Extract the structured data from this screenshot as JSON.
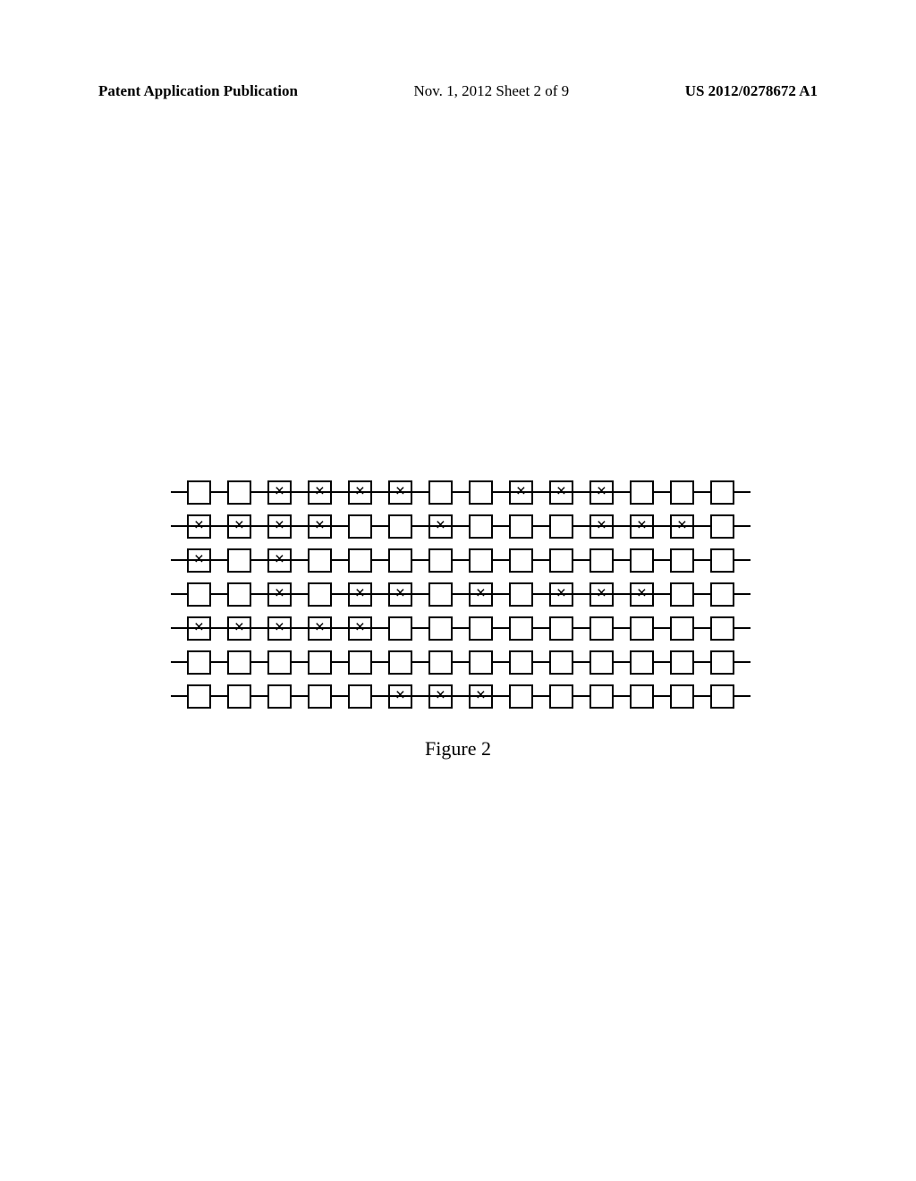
{
  "header": {
    "left": "Patent Application Publication",
    "center": "Nov. 1, 2012   Sheet 2 of 9",
    "right": "US 2012/0278672 A1"
  },
  "caption": "Figure 2",
  "chart_data": {
    "type": "table",
    "title": "Figure 2",
    "description": "7 rows of 14 cells each; 1 = marked (x with strike-through), 0 = empty",
    "rows": [
      [
        0,
        0,
        1,
        1,
        1,
        1,
        0,
        0,
        1,
        1,
        1,
        0,
        0,
        0
      ],
      [
        1,
        1,
        1,
        1,
        0,
        0,
        1,
        0,
        0,
        0,
        1,
        1,
        1,
        0
      ],
      [
        1,
        0,
        1,
        0,
        0,
        0,
        0,
        0,
        0,
        0,
        0,
        0,
        0,
        0
      ],
      [
        0,
        0,
        1,
        0,
        1,
        1,
        0,
        1,
        0,
        1,
        1,
        1,
        0,
        0
      ],
      [
        1,
        1,
        1,
        1,
        1,
        0,
        0,
        0,
        0,
        0,
        0,
        0,
        0,
        0
      ],
      [
        0,
        0,
        0,
        0,
        0,
        0,
        0,
        0,
        0,
        0,
        0,
        0,
        0,
        0
      ],
      [
        0,
        0,
        0,
        0,
        0,
        1,
        1,
        1,
        0,
        0,
        0,
        0,
        0,
        0
      ]
    ]
  }
}
